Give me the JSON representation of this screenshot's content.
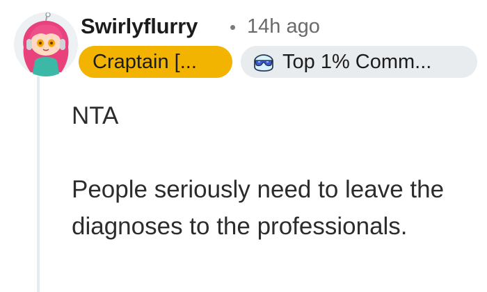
{
  "author": {
    "username": "Swirlyflurry",
    "separator": "•",
    "timestamp": "14h ago",
    "flair": "Craptain [...",
    "badge": {
      "icon": "sunglasses-badge-icon",
      "label": "Top 1% Comm..."
    }
  },
  "comment": {
    "paragraphs": [
      "NTA",
      "People seriously need to leave the diagnoses to the professionals."
    ]
  },
  "colors": {
    "flair_background": "#f2b400",
    "badge_background": "#e8ecef",
    "thread_line": "#e5ebee",
    "username": "#1c1c1c",
    "timestamp": "#6a6a6a"
  }
}
